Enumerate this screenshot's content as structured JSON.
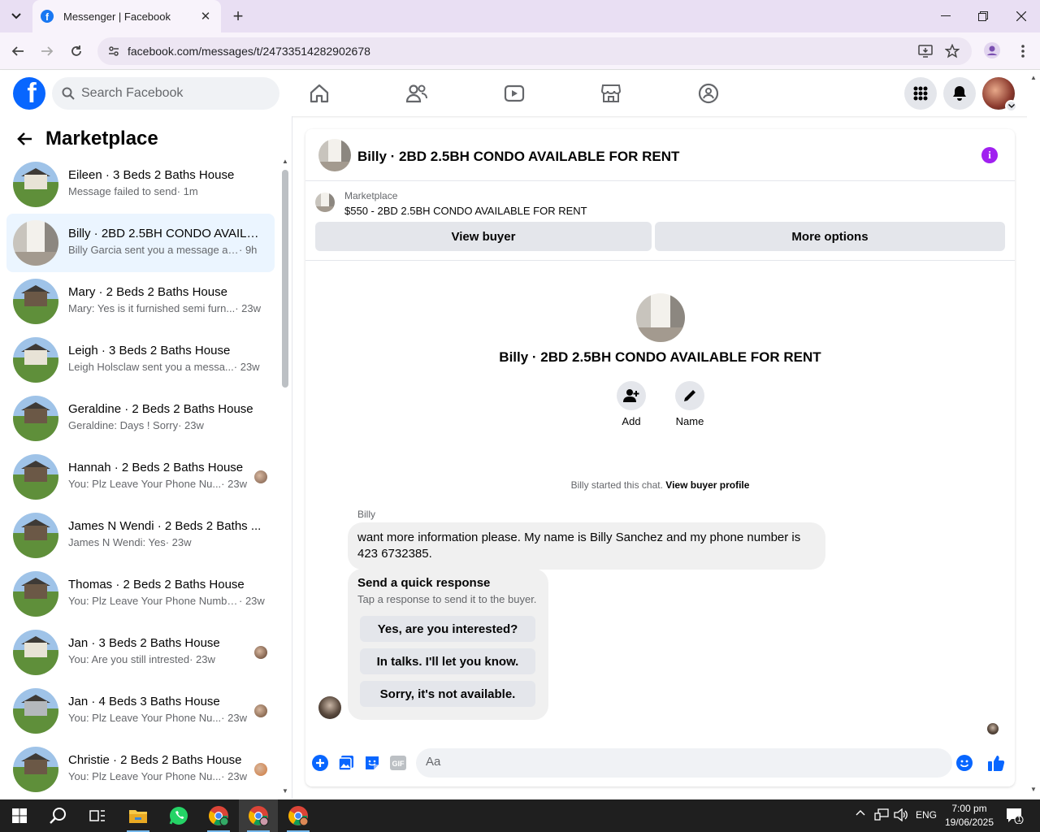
{
  "browser": {
    "tab_title": "Messenger | Facebook",
    "url": "facebook.com/messages/t/24733514282902678",
    "close_glyph": "✕",
    "new_tab_glyph": "+"
  },
  "fbnav": {
    "search_placeholder": "Search Facebook",
    "logo_letter": "f"
  },
  "left": {
    "title": "Marketplace",
    "conversations": [
      {
        "name": "Eileen · 3 Beds 2 Baths House",
        "snippet": "Message failed to send",
        "time": " · 1m",
        "thumb": "house-w",
        "active": false
      },
      {
        "name": "Billy · 2BD 2.5BH CONDO AVAILABLE FOR RENT",
        "snippet": "Billy Garcia sent you a message ab...",
        "time": " · 9h",
        "thumb": "condo",
        "active": true
      },
      {
        "name": "Mary · 2 Beds 2 Baths House",
        "snippet": "Mary: Yes is it furnished semi furn...",
        "time": " · 23w",
        "thumb": "house",
        "active": false
      },
      {
        "name": "Leigh · 3 Beds 2 Baths House",
        "snippet": "Leigh Holsclaw sent you a messa...",
        "time": " · 23w",
        "thumb": "house-w",
        "active": false
      },
      {
        "name": "Geraldine · 2 Beds 2 Baths House",
        "snippet": "Geraldine: Days ! Sorry",
        "time": " · 23w",
        "thumb": "house",
        "active": false
      },
      {
        "name": "Hannah · 2 Beds 2 Baths House",
        "snippet": "You: Plz Leave Your Phone Nu...",
        "time": " · 23w",
        "thumb": "house",
        "active": false
      },
      {
        "name": "James N Wendi · 2 Beds 2 Baths ...",
        "snippet": "James N Wendi: Yes",
        "time": " · 23w",
        "thumb": "house",
        "active": false
      },
      {
        "name": "Thomas · 2 Beds 2 Baths House",
        "snippet": "You: Plz Leave Your Phone Numbe...",
        "time": " · 23w",
        "thumb": "house",
        "active": false
      },
      {
        "name": "Jan · 3 Beds 2 Baths House",
        "snippet": "You: Are you still intrested",
        "time": " · 23w",
        "thumb": "house-w",
        "active": false
      },
      {
        "name": "Jan · 4 Beds 3 Baths House",
        "snippet": "You: Plz Leave Your Phone Nu...",
        "time": " · 23w",
        "thumb": "house-g",
        "active": false
      },
      {
        "name": "Christie · 2 Beds 2 Baths House",
        "snippet": "You: Plz Leave Your Phone Nu...",
        "time": " · 23w",
        "thumb": "house",
        "active": false
      }
    ]
  },
  "chat": {
    "title": "Billy · 2BD 2.5BH CONDO AVAILABLE FOR RENT",
    "info_glyph": "i",
    "marketplace_label": "Marketplace",
    "listing": "$550 - 2BD 2.5BH CONDO AVAILABLE FOR RENT",
    "view_buyer": "View buyer",
    "more_options": "More options",
    "profile_title": "Billy · 2BD 2.5BH CONDO AVAILABLE FOR RENT",
    "add_label": "Add",
    "name_label": "Name",
    "started_text": "Billy started this chat. ",
    "view_buyer_profile": "View buyer profile",
    "sender": "Billy",
    "message": "want more information please. My name is Billy Sanchez and my phone number is 423 6732385.",
    "quick_title": "Send a quick response",
    "quick_sub": "Tap a response to send it to the buyer.",
    "quick_responses": [
      "Yes, are you interested?",
      "In talks. I'll let you know.",
      "Sorry, it's not available."
    ],
    "composer_placeholder": "Aa"
  },
  "taskbar": {
    "lang": "ENG",
    "time": "7:00 pm",
    "date": "19/06/2025",
    "notif_count": "1"
  },
  "colors": {
    "fb_blue": "#0866ff",
    "messenger_purple": "#a020f0",
    "active_row": "#ebf5ff"
  }
}
